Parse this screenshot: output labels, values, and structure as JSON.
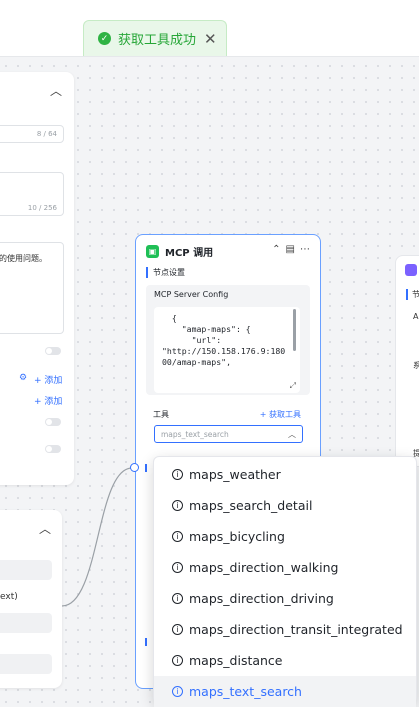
{
  "toast": {
    "text": "获取工具成功",
    "icon": "check-circle-icon"
  },
  "left_panel": {
    "counter1": "8 / 64",
    "counter2": "10 / 256",
    "text_snip": "的使用问题。",
    "add1": "+ 添加",
    "add2": "+ 添加",
    "row_snip": "ext)"
  },
  "node": {
    "title": "MCP 调用",
    "section": "节点设置",
    "config_label": "MCP Server Config",
    "config_code": "  {\n    \"amap-maps\": {\n      \"url\":\n\"http://150.158.176.9:180\n00/amap-maps\",",
    "tools_label": "工具",
    "get_tools": "+ 获取工具",
    "select_value": "maps_text_search"
  },
  "right_node": {
    "section": "节",
    "label1": "AI",
    "label2": "系",
    "label3": "提"
  },
  "dropdown": {
    "options": [
      "maps_weather",
      "maps_search_detail",
      "maps_bicycling",
      "maps_direction_walking",
      "maps_direction_driving",
      "maps_direction_transit_integrated",
      "maps_distance",
      "maps_text_search"
    ],
    "selected": "maps_text_search"
  }
}
